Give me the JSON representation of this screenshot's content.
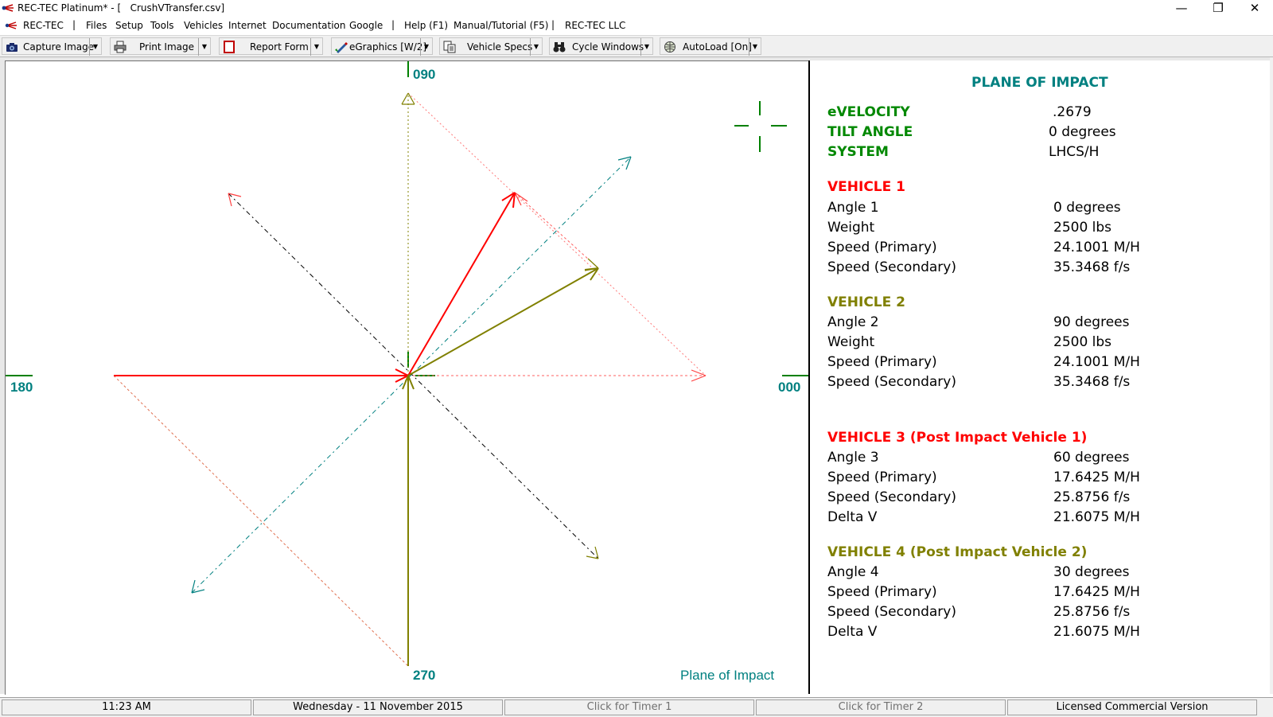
{
  "window": {
    "title": "REC-TEC Platinum* - [   CrushVTransfer.csv]",
    "minimize_glyph": "—",
    "restore_glyph": "❐",
    "close_glyph": "✕",
    "mdi_minimize": "–",
    "mdi_restore": "❐",
    "mdi_close": "✕"
  },
  "menu": {
    "items": [
      "REC-TEC",
      "|",
      "Files",
      "Setup",
      "Tools",
      "Vehicles",
      "Internet",
      "Documentation",
      "Google",
      "|",
      "Help (F1)",
      "Manual/Tutorial (F5)",
      "|",
      "REC-TEC LLC"
    ]
  },
  "toolbar": {
    "buttons": [
      {
        "label": "Capture Image",
        "icon": "camera-icon"
      },
      {
        "label": "Print Image",
        "icon": "printer-icon"
      },
      {
        "label": "Report Form",
        "icon": "report-icon"
      },
      {
        "label": "eGraphics [W/2]",
        "icon": "pen-icon"
      },
      {
        "label": "Vehicle Specs",
        "icon": "copy-icon"
      },
      {
        "label": "Cycle Windows",
        "icon": "binoculars-icon"
      },
      {
        "label": "AutoLoad [On]",
        "icon": "globe-icon"
      }
    ],
    "dropdown_glyph": "▼"
  },
  "plot": {
    "label_top": "090",
    "label_left": "180",
    "label_right": "000",
    "label_bottom": "270",
    "caption": "Plane of Impact"
  },
  "info": {
    "heading": "PLANE OF IMPACT",
    "summary": [
      {
        "label": "eVELOCITY",
        "value": ".2679"
      },
      {
        "label": "TILT ANGLE",
        "value": "0  degrees"
      },
      {
        "label": "SYSTEM",
        "value": "LHCS/H"
      }
    ],
    "vehicle1": {
      "heading": "VEHICLE  1",
      "rows": [
        {
          "label": "Angle 1",
          "value": "0  degrees"
        },
        {
          "label": "Weight",
          "value": "2500  lbs"
        },
        {
          "label": "Speed (Primary)",
          "value": "24.1001  M/H"
        },
        {
          "label": "Speed (Secondary)",
          "value": "35.3468  f/s"
        }
      ]
    },
    "vehicle2": {
      "heading": "VEHICLE  2",
      "rows": [
        {
          "label": "Angle 2",
          "value": "90  degrees"
        },
        {
          "label": "Weight",
          "value": "2500  lbs"
        },
        {
          "label": "Speed (Primary)",
          "value": "24.1001  M/H"
        },
        {
          "label": "Speed (Secondary)",
          "value": "35.3468  f/s"
        }
      ]
    },
    "vehicle3": {
      "heading": "VEHICLE  3    (Post Impact Vehicle 1)",
      "rows": [
        {
          "label": "Angle 3",
          "value": "60  degrees"
        },
        {
          "label": "Speed (Primary)",
          "value": "17.6425  M/H"
        },
        {
          "label": "Speed (Secondary)",
          "value": "25.8756  f/s"
        },
        {
          "label": "Delta V",
          "value": "21.6075  M/H"
        }
      ]
    },
    "vehicle4": {
      "heading": "VEHICLE  4    (Post Impact Vehicle 2)",
      "rows": [
        {
          "label": "Angle 4",
          "value": "30  degrees"
        },
        {
          "label": "Speed (Primary)",
          "value": "17.6425  M/H"
        },
        {
          "label": "Speed (Secondary)",
          "value": "25.8756  f/s"
        },
        {
          "label": "Delta V",
          "value": "21.6075  M/H"
        }
      ]
    }
  },
  "status": {
    "time": "11:23 AM",
    "date": "Wednesday   -   11 November 2015",
    "timer1": "Click for Timer 1",
    "timer2": "Click for Timer 2",
    "license": "Licensed Commercial Version"
  },
  "colors": {
    "vehicle1": "#ff0000",
    "vehicle2": "#808000",
    "axis_label": "#008080",
    "heading": "#008800"
  }
}
